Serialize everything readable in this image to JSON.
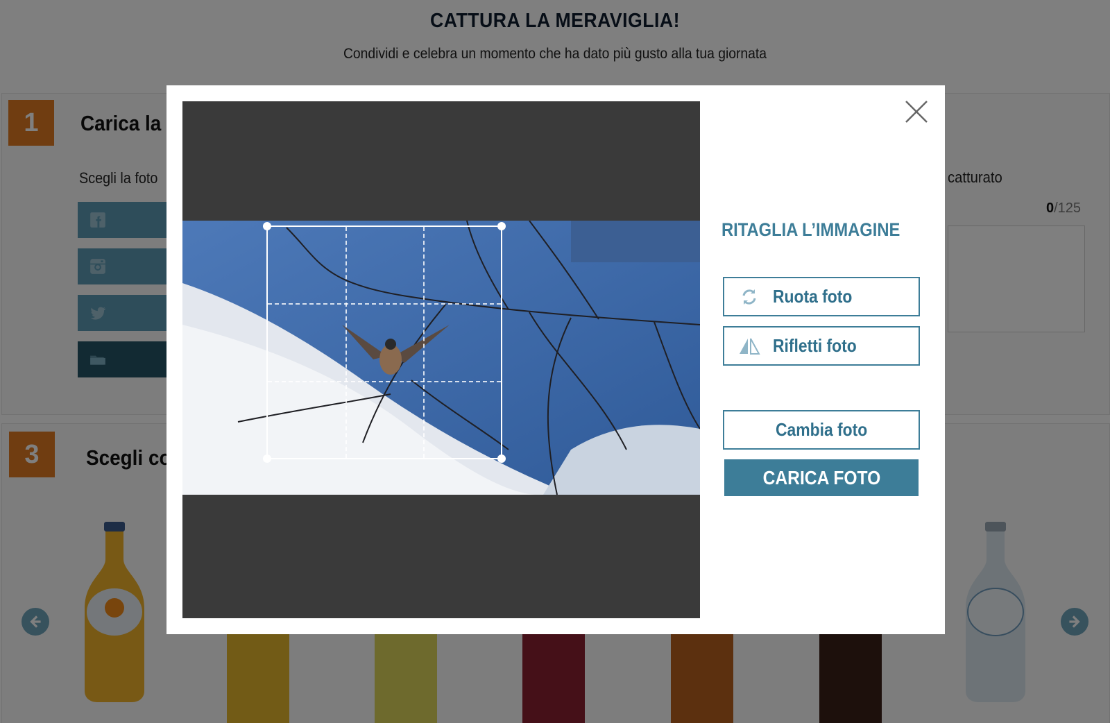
{
  "hero": {
    "title": "CATTURA LA MERAVIGLIA!",
    "subtitle": "Condividi e celebra un momento che ha dato più gusto alla tua giornata"
  },
  "step1": {
    "number": "1",
    "title": "Carica la foto",
    "choose_label": "Scegli la foto",
    "sources": [
      "facebook-icon",
      "instagram-icon",
      "twitter-icon",
      "folder-icon"
    ]
  },
  "caption": {
    "label": "catturato",
    "count": "0",
    "max": "/125"
  },
  "step3": {
    "number": "3",
    "title": "Scegli con"
  },
  "modal": {
    "tools_title": "RITAGLIA L’IMMAGINE",
    "rotate_label": "Ruota foto",
    "flip_label": "Rifletti foto",
    "change_label": "Cambia foto",
    "upload_label": "CARICA FOTO",
    "close_icon": "close-icon"
  },
  "colors": {
    "accent": "#3d7d98",
    "step_badge": "#e07b22",
    "source_button": "#5d9ab4",
    "source_button_active": "#245467"
  }
}
